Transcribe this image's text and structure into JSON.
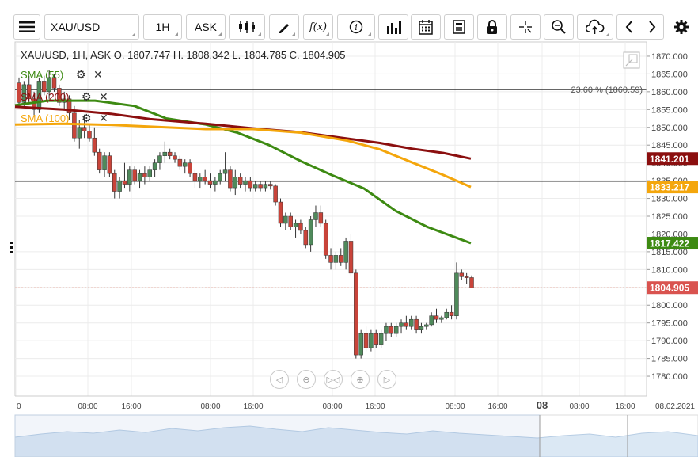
{
  "toolbar": {
    "symbol": "XAU/USD",
    "timeframe": "1H",
    "price_side": "ASK",
    "function_label": "f(x)",
    "icons": [
      "menu-icon",
      "candlestick-type-icon",
      "draw-pen-icon",
      "function-icon",
      "info-icon",
      "volume-bars-icon",
      "calendar-icon",
      "news-icon",
      "lock-icon",
      "crosshair-icon",
      "zoom-icon",
      "cloud-upload-icon",
      "chevron-left-icon",
      "chevron-right-icon",
      "settings-gear-icon"
    ]
  },
  "info_line": "XAU/USD, 1H, ASK   O. 1807.747 H. 1808.342 L. 1804.785 C. 1804.905",
  "indicators": [
    {
      "label": "SMA (55)",
      "color": "#3d8a12"
    },
    {
      "label": "SMA (200)",
      "color": "#8b0f0f"
    },
    {
      "label": "SMA (100)",
      "color": "#f4a60c"
    }
  ],
  "fib_label": "23.60 % (1860.59)",
  "price_tags": [
    {
      "text": "1841.201",
      "value": 1841.201,
      "color": "#8b0f0f"
    },
    {
      "text": "1833.217",
      "value": 1833.217,
      "color": "#f4a60c"
    },
    {
      "text": "1817.422",
      "value": 1817.422,
      "color": "#3d8a12"
    },
    {
      "text": "1804.905",
      "value": 1804.905,
      "color": "#d9534f"
    }
  ],
  "bottom_scrollbar_label": "08.02.2021",
  "chart_data": {
    "type": "candlestick",
    "symbol": "XAU/USD",
    "timeframe": "1H",
    "ylim": [
      1776,
      1874
    ],
    "y_ticks": [
      "1780.000",
      "1785.000",
      "1790.000",
      "1795.000",
      "1800.000",
      "1805.000",
      "1810.000",
      "1815.000",
      "1820.000",
      "1825.000",
      "1830.000",
      "1835.000",
      "1840.000",
      "1845.000",
      "1850.000",
      "1855.000",
      "1860.000",
      "1865.000",
      "1870.000"
    ],
    "x_ticks": [
      "0",
      "08:00",
      "16:00",
      "08:00",
      "16:00",
      "08:00",
      "16:00",
      "08:00",
      "16:00",
      "08",
      "08:00",
      "16:00",
      "08.02.2021"
    ],
    "ohlc": [
      [
        1862.5,
        1864.0,
        1856.0,
        1857.0
      ],
      [
        1857.0,
        1863.0,
        1856.0,
        1862.0
      ],
      [
        1862.0,
        1864.5,
        1857.0,
        1858.0
      ],
      [
        1858.0,
        1860.0,
        1853.0,
        1855.0
      ],
      [
        1855.0,
        1864.0,
        1854.0,
        1863.0
      ],
      [
        1863.0,
        1864.5,
        1859.0,
        1860.0
      ],
      [
        1860.0,
        1866.0,
        1858.0,
        1864.0
      ],
      [
        1864.0,
        1865.0,
        1860.0,
        1861.0
      ],
      [
        1861.0,
        1862.0,
        1856.0,
        1857.0
      ],
      [
        1857.0,
        1860.0,
        1855.0,
        1858.0
      ],
      [
        1858.0,
        1859.0,
        1852.0,
        1854.0
      ],
      [
        1854.0,
        1856.0,
        1846.0,
        1847.0
      ],
      [
        1847.0,
        1852.0,
        1844.0,
        1850.0
      ],
      [
        1850.0,
        1853.0,
        1847.0,
        1849.0
      ],
      [
        1849.0,
        1851.0,
        1846.0,
        1847.0
      ],
      [
        1847.0,
        1850.0,
        1842.0,
        1843.0
      ],
      [
        1843.0,
        1844.0,
        1837.0,
        1838.0
      ],
      [
        1838.0,
        1843.0,
        1836.0,
        1842.0
      ],
      [
        1842.0,
        1843.0,
        1836.0,
        1837.0
      ],
      [
        1837.0,
        1838.0,
        1830.0,
        1832.0
      ],
      [
        1832.0,
        1836.0,
        1830.0,
        1835.0
      ],
      [
        1835.0,
        1840.0,
        1833.0,
        1834.0
      ],
      [
        1834.0,
        1839.0,
        1832.0,
        1838.0
      ],
      [
        1838.0,
        1839.0,
        1834.0,
        1835.0
      ],
      [
        1835.0,
        1838.0,
        1833.0,
        1837.0
      ],
      [
        1837.0,
        1839.0,
        1834.0,
        1836.0
      ],
      [
        1836.0,
        1839.0,
        1835.0,
        1838.0
      ],
      [
        1838.0,
        1841.0,
        1836.0,
        1840.0
      ],
      [
        1840.0,
        1843.0,
        1838.0,
        1842.0
      ],
      [
        1842.0,
        1846.0,
        1840.0,
        1843.0
      ],
      [
        1843.0,
        1844.0,
        1841.0,
        1842.0
      ],
      [
        1842.0,
        1843.0,
        1840.0,
        1841.0
      ],
      [
        1841.0,
        1842.0,
        1838.0,
        1839.0
      ],
      [
        1839.0,
        1841.0,
        1837.0,
        1840.0
      ],
      [
        1840.0,
        1841.0,
        1836.0,
        1837.0
      ],
      [
        1837.0,
        1838.0,
        1833.0,
        1835.0
      ],
      [
        1835.0,
        1837.0,
        1833.0,
        1836.0
      ],
      [
        1836.0,
        1838.0,
        1834.0,
        1835.0
      ],
      [
        1835.0,
        1837.0,
        1833.0,
        1834.0
      ],
      [
        1834.0,
        1836.0,
        1832.0,
        1835.0
      ],
      [
        1835.0,
        1838.0,
        1834.0,
        1837.0
      ],
      [
        1837.0,
        1843.0,
        1835.0,
        1838.0
      ],
      [
        1838.0,
        1839.0,
        1832.0,
        1833.0
      ],
      [
        1833.0,
        1838.0,
        1831.0,
        1836.0
      ],
      [
        1836.0,
        1837.0,
        1833.0,
        1834.0
      ],
      [
        1834.0,
        1836.0,
        1832.0,
        1835.0
      ],
      [
        1835.0,
        1836.0,
        1832.0,
        1833.0
      ],
      [
        1833.0,
        1835.0,
        1832.0,
        1834.0
      ],
      [
        1834.0,
        1835.0,
        1832.0,
        1833.0
      ],
      [
        1833.0,
        1835.0,
        1832.0,
        1834.0
      ],
      [
        1834.0,
        1835.0,
        1832.5,
        1833.5
      ],
      [
        1833.5,
        1834.0,
        1828.0,
        1829.0
      ],
      [
        1829.0,
        1830.0,
        1822.0,
        1823.0
      ],
      [
        1823.0,
        1826.0,
        1821.0,
        1825.0
      ],
      [
        1825.0,
        1826.0,
        1821.0,
        1822.0
      ],
      [
        1822.0,
        1824.0,
        1819.0,
        1823.0
      ],
      [
        1823.0,
        1824.0,
        1820.0,
        1821.0
      ],
      [
        1821.0,
        1822.0,
        1816.0,
        1817.0
      ],
      [
        1817.0,
        1825.0,
        1815.0,
        1824.0
      ],
      [
        1824.0,
        1828.0,
        1822.0,
        1826.0
      ],
      [
        1826.0,
        1828.0,
        1822.0,
        1823.0
      ],
      [
        1823.0,
        1824.0,
        1813.0,
        1814.0
      ],
      [
        1814.0,
        1816.0,
        1810.0,
        1812.0
      ],
      [
        1812.0,
        1815.0,
        1810.0,
        1814.0
      ],
      [
        1814.0,
        1816.0,
        1811.0,
        1812.0
      ],
      [
        1812.0,
        1819.0,
        1810.0,
        1818.0
      ],
      [
        1818.0,
        1820.0,
        1808.0,
        1809.0
      ],
      [
        1809.0,
        1810.0,
        1785.0,
        1786.0
      ],
      [
        1786.0,
        1793.0,
        1785.0,
        1792.0
      ],
      [
        1792.0,
        1794.0,
        1787.0,
        1788.0
      ],
      [
        1788.0,
        1793.0,
        1787.0,
        1792.0
      ],
      [
        1792.0,
        1793.0,
        1788.0,
        1789.0
      ],
      [
        1789.0,
        1793.0,
        1788.0,
        1792.0
      ],
      [
        1792.0,
        1795.0,
        1790.0,
        1794.0
      ],
      [
        1794.0,
        1795.0,
        1791.0,
        1792.0
      ],
      [
        1792.0,
        1795.0,
        1791.0,
        1794.0
      ],
      [
        1794.0,
        1796.0,
        1792.0,
        1795.0
      ],
      [
        1795.0,
        1797.0,
        1793.0,
        1794.0
      ],
      [
        1794.0,
        1797.0,
        1793.0,
        1796.0
      ],
      [
        1796.0,
        1797.0,
        1792.0,
        1793.0
      ],
      [
        1793.0,
        1795.0,
        1792.0,
        1794.0
      ],
      [
        1794.0,
        1795.0,
        1793.0,
        1794.5
      ],
      [
        1794.5,
        1798.0,
        1794.0,
        1797.0
      ],
      [
        1797.0,
        1799.0,
        1795.0,
        1796.0
      ],
      [
        1796.0,
        1797.0,
        1795.0,
        1796.5
      ],
      [
        1796.5,
        1799.0,
        1796.0,
        1798.0
      ],
      [
        1798.0,
        1800.0,
        1796.0,
        1797.0
      ],
      [
        1797.0,
        1812.0,
        1796.0,
        1809.0
      ],
      [
        1809.0,
        1810.0,
        1807.0,
        1808.0
      ],
      [
        1808.0,
        1809.0,
        1806.0,
        1807.7
      ],
      [
        1807.747,
        1808.342,
        1804.785,
        1804.905
      ]
    ],
    "series": [
      {
        "name": "SMA (55)",
        "start_index": 0,
        "end_value": 1817.422,
        "color": "#3d8a12"
      },
      {
        "name": "SMA (200)",
        "start_index": 0,
        "end_value": 1841.201,
        "color": "#8b0f0f"
      },
      {
        "name": "SMA (100)",
        "start_index": 0,
        "end_value": 1833.217,
        "color": "#f4a60c"
      }
    ],
    "horizontal_lines": [
      1860.59,
      1834.8
    ],
    "last_price": 1804.905
  }
}
